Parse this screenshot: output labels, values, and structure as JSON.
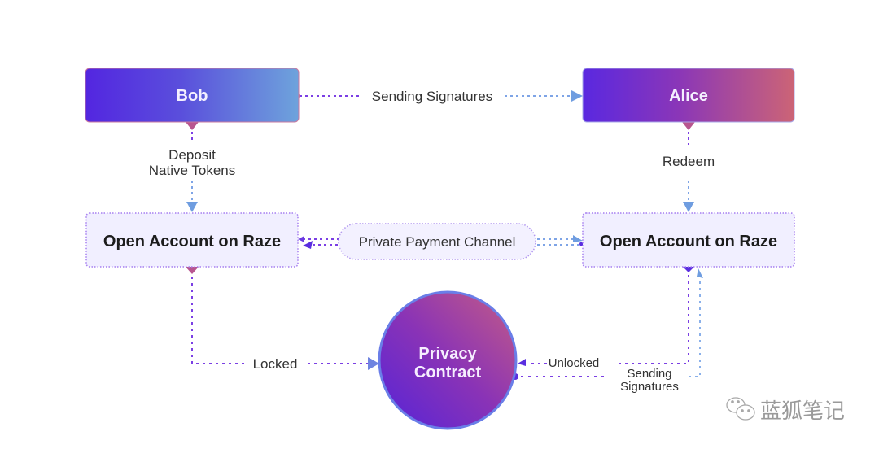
{
  "diagram": {
    "nodes": {
      "bob": "Bob",
      "alice": "Alice",
      "bob_account": "Open Account on Raze",
      "alice_account": "Open Account on Raze",
      "channel": "Private Payment Channel",
      "contract_line1": "Privacy",
      "contract_line2": "Contract"
    },
    "edges": {
      "bob_to_alice": "Sending Signatures",
      "deposit_line1": "Deposit",
      "deposit_line2": "Native Tokens",
      "redeem": "Redeem",
      "locked": "Locked",
      "unlocked": "Unlocked",
      "sending_sig_line1": "Sending",
      "sending_sig_line2": "Signatures"
    },
    "colors": {
      "purple": "#5a2ee0",
      "pink": "#b8568f",
      "blue": "#6d9ee0",
      "box_fill": "#f1efff",
      "dot_purple": "#7b4be8",
      "dot_blue": "#8ab0ea"
    }
  },
  "watermark": {
    "text": "蓝狐笔记",
    "icon": "wechat-icon"
  }
}
